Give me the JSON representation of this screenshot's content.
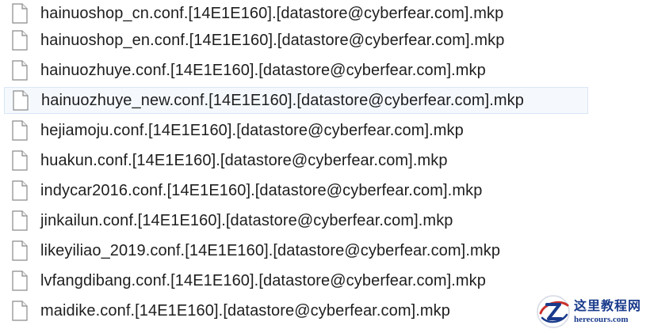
{
  "files": [
    {
      "name": "hainuoshop_cn.conf.[14E1E160].[datastore@cyberfear.com].mkp",
      "icon": "document-icon"
    },
    {
      "name": "hainuoshop_en.conf.[14E1E160].[datastore@cyberfear.com].mkp",
      "icon": "document-icon"
    },
    {
      "name": "hainuozhuye.conf.[14E1E160].[datastore@cyberfear.com].mkp",
      "icon": "document-icon"
    },
    {
      "name": "hainuozhuye_new.conf.[14E1E160].[datastore@cyberfear.com].mkp",
      "icon": "document-icon",
      "hovered": true
    },
    {
      "name": "hejiamoju.conf.[14E1E160].[datastore@cyberfear.com].mkp",
      "icon": "document-icon"
    },
    {
      "name": "huakun.conf.[14E1E160].[datastore@cyberfear.com].mkp",
      "icon": "document-icon"
    },
    {
      "name": "indycar2016.conf.[14E1E160].[datastore@cyberfear.com].mkp",
      "icon": "document-icon"
    },
    {
      "name": "jinkailun.conf.[14E1E160].[datastore@cyberfear.com].mkp",
      "icon": "document-icon"
    },
    {
      "name": "likeyiliao_2019.conf.[14E1E160].[datastore@cyberfear.com].mkp",
      "icon": "document-icon"
    },
    {
      "name": "lvfangdibang.conf.[14E1E160].[datastore@cyberfear.com].mkp",
      "icon": "document-icon"
    },
    {
      "name": "maidike.conf.[14E1E160].[datastore@cyberfear.com].mkp",
      "icon": "document-icon"
    }
  ],
  "watermark": {
    "title": "这里教程网",
    "url": "herecours.com",
    "logo_icon": "z-logo-icon",
    "brand_color": "#1a3b8c"
  },
  "colors": {
    "hover_background": "#f5f9fe",
    "hover_border": "#d9e6f7",
    "text": "#1e1e1e"
  }
}
